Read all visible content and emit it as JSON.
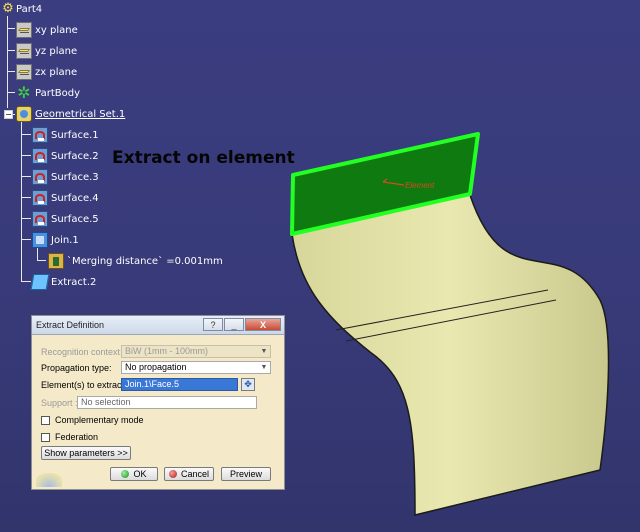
{
  "tree": {
    "root": {
      "label": "Part4",
      "icon": "part-icon"
    },
    "planes": [
      {
        "label": "xy plane",
        "icon": "plane-icon"
      },
      {
        "label": "yz plane",
        "icon": "plane-icon"
      },
      {
        "label": "zx plane",
        "icon": "plane-icon"
      }
    ],
    "part_body": {
      "label": "PartBody",
      "icon": "gear-icon"
    },
    "geo_set": {
      "label": "Geometrical Set.1",
      "icon": "geometrical-set-icon"
    },
    "surfaces": [
      {
        "label": "Surface.1",
        "icon": "surface-icon"
      },
      {
        "label": "Surface.2",
        "icon": "surface-icon"
      },
      {
        "label": "Surface.3",
        "icon": "surface-icon"
      },
      {
        "label": "Surface.4",
        "icon": "surface-icon"
      },
      {
        "label": "Surface.5",
        "icon": "surface-icon"
      }
    ],
    "join": {
      "label": "Join.1",
      "icon": "join-icon"
    },
    "merging": {
      "label": "`Merging distance` =0.001mm",
      "icon": "parameter-icon"
    },
    "extract": {
      "label": "Extract.2",
      "icon": "extract-icon"
    }
  },
  "annotation": "Extract on element",
  "viewport": {
    "element_label": "Element",
    "surface_color": "#e6e6a6",
    "selected_face_color": "#0f7a0f",
    "highlight_color": "#22ff22",
    "label_color": "#d84a20"
  },
  "dialog": {
    "title": "Extract Definition",
    "title_buttons": {
      "help": "?",
      "minimize": "_",
      "close": "X"
    },
    "recognition_context": {
      "label": "Recognition context:",
      "value": "BiW (1mm - 100mm)",
      "disabled": true
    },
    "propagation": {
      "label": "Propagation type:",
      "value": "No propagation"
    },
    "elements": {
      "label": "Element(s) to extract:",
      "value": "Join.1\\Face.5"
    },
    "support": {
      "label": "Support :",
      "value": "No selection"
    },
    "complementary_mode": {
      "label": "Complementary mode",
      "checked": false
    },
    "federation": {
      "label": "Federation",
      "checked": false
    },
    "show_parameters": "Show parameters >>",
    "ok": "OK",
    "cancel": "Cancel",
    "preview": "Preview"
  }
}
